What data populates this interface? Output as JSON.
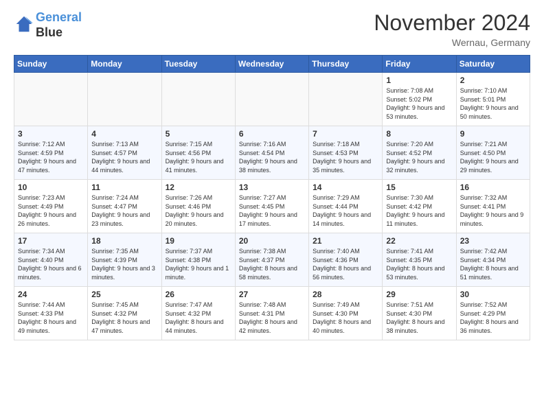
{
  "header": {
    "logo_line1": "General",
    "logo_line2": "Blue",
    "month_title": "November 2024",
    "location": "Wernau, Germany"
  },
  "weekdays": [
    "Sunday",
    "Monday",
    "Tuesday",
    "Wednesday",
    "Thursday",
    "Friday",
    "Saturday"
  ],
  "days": [
    {
      "date": "",
      "empty": true
    },
    {
      "date": "",
      "empty": true
    },
    {
      "date": "",
      "empty": true
    },
    {
      "date": "",
      "empty": true
    },
    {
      "date": "",
      "empty": true
    },
    {
      "date": "1",
      "sunrise": "7:08 AM",
      "sunset": "5:02 PM",
      "daylight": "9 hours and 53 minutes."
    },
    {
      "date": "2",
      "sunrise": "7:10 AM",
      "sunset": "5:01 PM",
      "daylight": "9 hours and 50 minutes."
    },
    {
      "date": "3",
      "sunrise": "7:12 AM",
      "sunset": "4:59 PM",
      "daylight": "9 hours and 47 minutes."
    },
    {
      "date": "4",
      "sunrise": "7:13 AM",
      "sunset": "4:57 PM",
      "daylight": "9 hours and 44 minutes."
    },
    {
      "date": "5",
      "sunrise": "7:15 AM",
      "sunset": "4:56 PM",
      "daylight": "9 hours and 41 minutes."
    },
    {
      "date": "6",
      "sunrise": "7:16 AM",
      "sunset": "4:54 PM",
      "daylight": "9 hours and 38 minutes."
    },
    {
      "date": "7",
      "sunrise": "7:18 AM",
      "sunset": "4:53 PM",
      "daylight": "9 hours and 35 minutes."
    },
    {
      "date": "8",
      "sunrise": "7:20 AM",
      "sunset": "4:52 PM",
      "daylight": "9 hours and 32 minutes."
    },
    {
      "date": "9",
      "sunrise": "7:21 AM",
      "sunset": "4:50 PM",
      "daylight": "9 hours and 29 minutes."
    },
    {
      "date": "10",
      "sunrise": "7:23 AM",
      "sunset": "4:49 PM",
      "daylight": "9 hours and 26 minutes."
    },
    {
      "date": "11",
      "sunrise": "7:24 AM",
      "sunset": "4:47 PM",
      "daylight": "9 hours and 23 minutes."
    },
    {
      "date": "12",
      "sunrise": "7:26 AM",
      "sunset": "4:46 PM",
      "daylight": "9 hours and 20 minutes."
    },
    {
      "date": "13",
      "sunrise": "7:27 AM",
      "sunset": "4:45 PM",
      "daylight": "9 hours and 17 minutes."
    },
    {
      "date": "14",
      "sunrise": "7:29 AM",
      "sunset": "4:44 PM",
      "daylight": "9 hours and 14 minutes."
    },
    {
      "date": "15",
      "sunrise": "7:30 AM",
      "sunset": "4:42 PM",
      "daylight": "9 hours and 11 minutes."
    },
    {
      "date": "16",
      "sunrise": "7:32 AM",
      "sunset": "4:41 PM",
      "daylight": "9 hours and 9 minutes."
    },
    {
      "date": "17",
      "sunrise": "7:34 AM",
      "sunset": "4:40 PM",
      "daylight": "9 hours and 6 minutes."
    },
    {
      "date": "18",
      "sunrise": "7:35 AM",
      "sunset": "4:39 PM",
      "daylight": "9 hours and 3 minutes."
    },
    {
      "date": "19",
      "sunrise": "7:37 AM",
      "sunset": "4:38 PM",
      "daylight": "9 hours and 1 minute."
    },
    {
      "date": "20",
      "sunrise": "7:38 AM",
      "sunset": "4:37 PM",
      "daylight": "8 hours and 58 minutes."
    },
    {
      "date": "21",
      "sunrise": "7:40 AM",
      "sunset": "4:36 PM",
      "daylight": "8 hours and 56 minutes."
    },
    {
      "date": "22",
      "sunrise": "7:41 AM",
      "sunset": "4:35 PM",
      "daylight": "8 hours and 53 minutes."
    },
    {
      "date": "23",
      "sunrise": "7:42 AM",
      "sunset": "4:34 PM",
      "daylight": "8 hours and 51 minutes."
    },
    {
      "date": "24",
      "sunrise": "7:44 AM",
      "sunset": "4:33 PM",
      "daylight": "8 hours and 49 minutes."
    },
    {
      "date": "25",
      "sunrise": "7:45 AM",
      "sunset": "4:32 PM",
      "daylight": "8 hours and 47 minutes."
    },
    {
      "date": "26",
      "sunrise": "7:47 AM",
      "sunset": "4:32 PM",
      "daylight": "8 hours and 44 minutes."
    },
    {
      "date": "27",
      "sunrise": "7:48 AM",
      "sunset": "4:31 PM",
      "daylight": "8 hours and 42 minutes."
    },
    {
      "date": "28",
      "sunrise": "7:49 AM",
      "sunset": "4:30 PM",
      "daylight": "8 hours and 40 minutes."
    },
    {
      "date": "29",
      "sunrise": "7:51 AM",
      "sunset": "4:30 PM",
      "daylight": "8 hours and 38 minutes."
    },
    {
      "date": "30",
      "sunrise": "7:52 AM",
      "sunset": "4:29 PM",
      "daylight": "8 hours and 36 minutes."
    }
  ]
}
